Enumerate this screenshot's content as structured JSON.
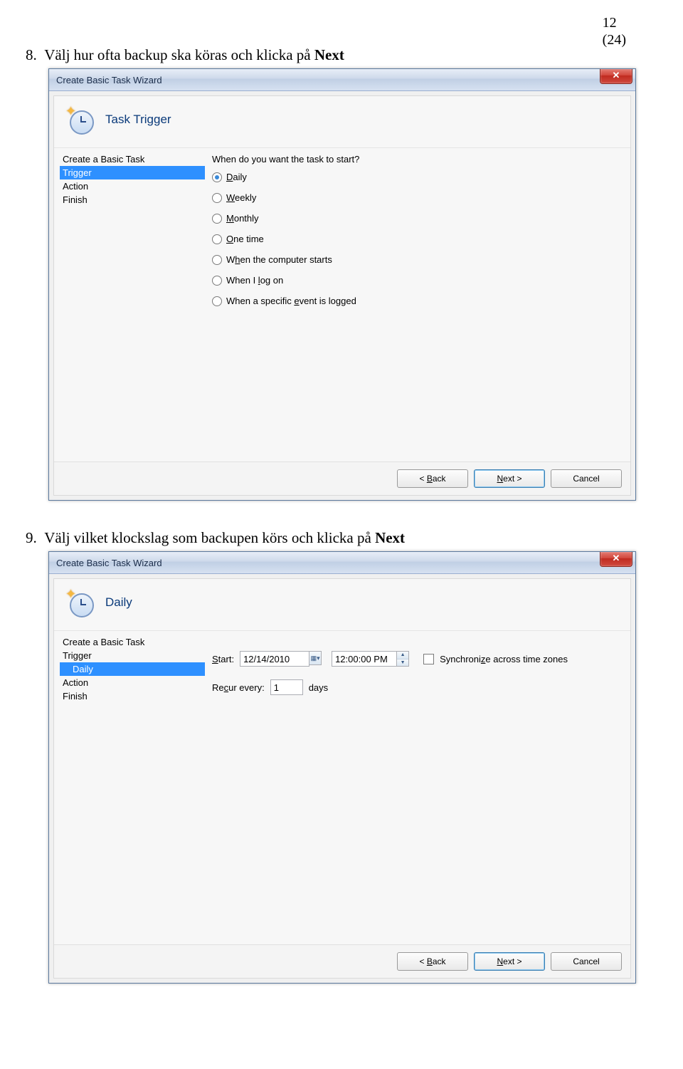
{
  "page": {
    "num": "12",
    "total": "(24)"
  },
  "caption1": {
    "num": "8.",
    "text": "Välj hur ofta backup ska köras och klicka på ",
    "bold": "Next"
  },
  "caption2": {
    "num": "9.",
    "text": "Välj vilket klockslag som backupen körs och klicka på ",
    "bold": "Next"
  },
  "dlg1": {
    "title": "Create Basic Task Wizard",
    "header": "Task Trigger",
    "sidebar": [
      "Create a Basic Task",
      "Trigger",
      "Action",
      "Finish"
    ],
    "selected": 1,
    "prompt": "When do you want the task to start?",
    "options": [
      {
        "pre": "",
        "u": "D",
        "post": "aily",
        "checked": true
      },
      {
        "pre": "",
        "u": "W",
        "post": "eekly",
        "checked": false
      },
      {
        "pre": "",
        "u": "M",
        "post": "onthly",
        "checked": false
      },
      {
        "pre": "",
        "u": "O",
        "post": "ne time",
        "checked": false
      },
      {
        "pre": "W",
        "u": "h",
        "post": "en the computer starts",
        "checked": false
      },
      {
        "pre": "When I ",
        "u": "l",
        "post": "og on",
        "checked": false
      },
      {
        "pre": "When a specific ",
        "u": "e",
        "post": "vent is logged",
        "checked": false
      }
    ],
    "buttons": {
      "back": "< Back",
      "next": "Next >",
      "cancel": "Cancel"
    }
  },
  "dlg2": {
    "title": "Create Basic Task Wizard",
    "header": "Daily",
    "sidebar": [
      "Create a Basic Task",
      "Trigger",
      "Daily",
      "Action",
      "Finish"
    ],
    "selected": 2,
    "start_label_pre": "",
    "start_u": "S",
    "start_label_post": "tart:",
    "date": "12/14/2010",
    "time": "12:00:00 PM",
    "sync_label_pre": "Synchroni",
    "sync_u": "z",
    "sync_label_post": "e across time zones",
    "recur_label_pre": "Re",
    "recur_u": "c",
    "recur_label_post": "ur every:",
    "recur_value": "1",
    "recur_unit": "days",
    "buttons": {
      "back": "< Back",
      "next": "Next >",
      "cancel": "Cancel"
    }
  }
}
